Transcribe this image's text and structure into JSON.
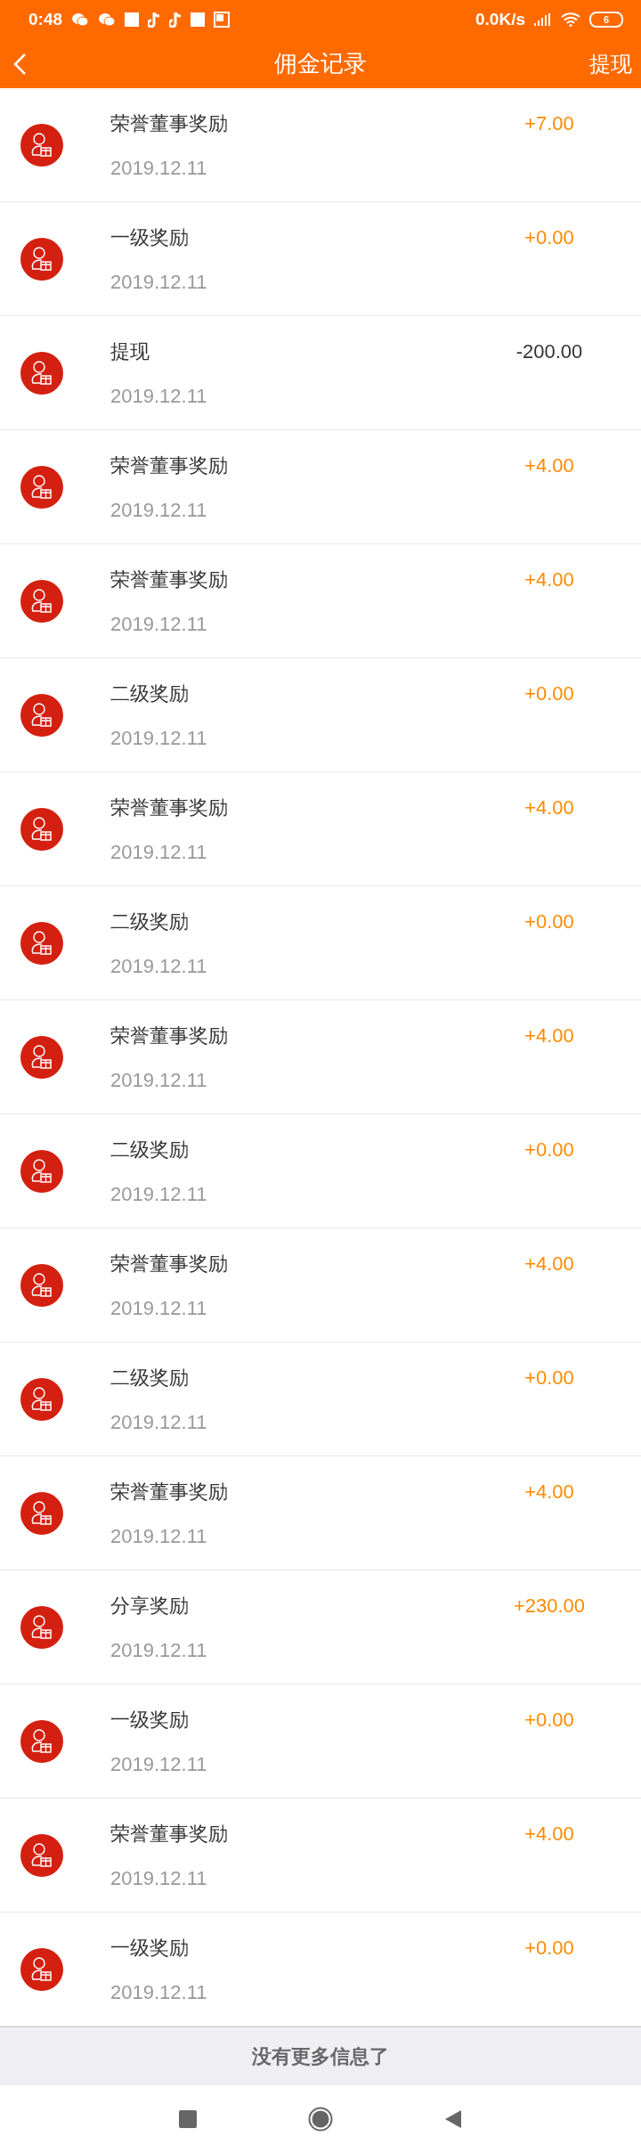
{
  "status_bar": {
    "time": "0:48",
    "speed": "0.0K/s",
    "battery": "6"
  },
  "header": {
    "title": "佣金记录",
    "action": "提现"
  },
  "records": [
    {
      "title": "荣誉董事奖励",
      "date": "2019.12.11",
      "amount": "+7.00",
      "kind": "income"
    },
    {
      "title": "一级奖励",
      "date": "2019.12.11",
      "amount": "+0.00",
      "kind": "income"
    },
    {
      "title": "提现",
      "date": "2019.12.11",
      "amount": "-200.00",
      "kind": "withdrawal"
    },
    {
      "title": "荣誉董事奖励",
      "date": "2019.12.11",
      "amount": "+4.00",
      "kind": "income"
    },
    {
      "title": "荣誉董事奖励",
      "date": "2019.12.11",
      "amount": "+4.00",
      "kind": "income"
    },
    {
      "title": "二级奖励",
      "date": "2019.12.11",
      "amount": "+0.00",
      "kind": "income"
    },
    {
      "title": "荣誉董事奖励",
      "date": "2019.12.11",
      "amount": "+4.00",
      "kind": "income"
    },
    {
      "title": "二级奖励",
      "date": "2019.12.11",
      "amount": "+0.00",
      "kind": "income"
    },
    {
      "title": "荣誉董事奖励",
      "date": "2019.12.11",
      "amount": "+4.00",
      "kind": "income"
    },
    {
      "title": "二级奖励",
      "date": "2019.12.11",
      "amount": "+0.00",
      "kind": "income"
    },
    {
      "title": "荣誉董事奖励",
      "date": "2019.12.11",
      "amount": "+4.00",
      "kind": "income"
    },
    {
      "title": "二级奖励",
      "date": "2019.12.11",
      "amount": "+0.00",
      "kind": "income"
    },
    {
      "title": "荣誉董事奖励",
      "date": "2019.12.11",
      "amount": "+4.00",
      "kind": "income"
    },
    {
      "title": "分享奖励",
      "date": "2019.12.11",
      "amount": "+230.00",
      "kind": "income"
    },
    {
      "title": "一级奖励",
      "date": "2019.12.11",
      "amount": "+0.00",
      "kind": "income"
    },
    {
      "title": "荣誉董事奖励",
      "date": "2019.12.11",
      "amount": "+4.00",
      "kind": "income"
    },
    {
      "title": "一级奖励",
      "date": "2019.12.11",
      "amount": "+0.00",
      "kind": "income"
    }
  ],
  "footer": "没有更多信息了"
}
